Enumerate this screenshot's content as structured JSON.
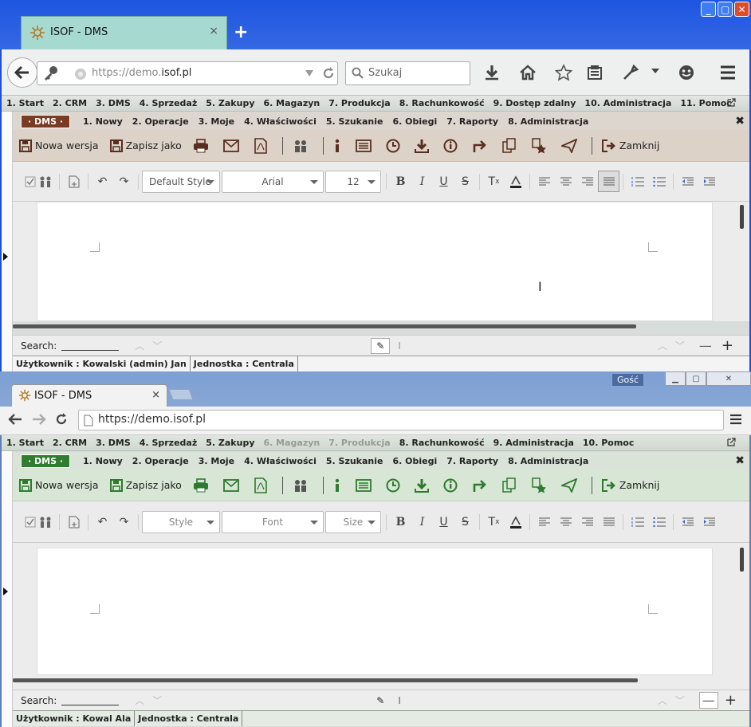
{
  "w1": {
    "tab_title": "ISOF - DMS",
    "tab_close": "×",
    "new_tab": "+",
    "url_prefix": "https://demo.",
    "url_host": "isof.pl",
    "search_placeholder": "Szukaj",
    "main_menu": [
      "1. Start",
      "2. CRM",
      "3. DMS",
      "4. Sprzedaż",
      "5. Zakupy",
      "6. Magazyn",
      "7. Produkcja",
      "8. Rachunkowość",
      "9. Dostęp zdalny",
      "10. Administracja",
      "11. Pomoc"
    ],
    "dms_badge": "· DMS ·",
    "sub_menu": [
      "1. Nowy",
      "2. Operacje",
      "3. Moje",
      "4. Właściwości",
      "5. Szukanie",
      "6. Obiegi",
      "7. Raporty",
      "8. Administracja"
    ],
    "new_version": "Nowa wersja",
    "save_as": "Zapisz jako",
    "close": "Zamknij",
    "style_select": "Default Style",
    "font_select": "Arial",
    "size_select": "12",
    "search_label": "Search:",
    "status_user": "Użytkownik : Kowalski (admin) Jan",
    "status_unit": "Jednostka : Centrala"
  },
  "w2": {
    "tab_title": "ISOF - DMS",
    "tab_close": "×",
    "guest": "Gość",
    "url": "https://demo.isof.pl",
    "main_menu": [
      "1. Start",
      "2. CRM",
      "3. DMS",
      "4. Sprzedaż",
      "5. Zakupy",
      "6. Magazyn",
      "7. Produkcja",
      "8. Rachunkowość",
      "9. Administracja",
      "10. Pomoc"
    ],
    "main_menu_disabled": [
      false,
      false,
      false,
      false,
      false,
      true,
      true,
      false,
      false,
      false
    ],
    "dms_badge": "· DMS ·",
    "sub_menu": [
      "1. Nowy",
      "2. Operacje",
      "3. Moje",
      "4. Właściwości",
      "5. Szukanie",
      "6. Obiegi",
      "7. Raporty",
      "8. Administracja"
    ],
    "new_version": "Nowa wersja",
    "save_as": "Zapisz jako",
    "close": "Zamknij",
    "style_select": "Style",
    "font_select": "Font",
    "size_select": "Size",
    "search_label": "Search:",
    "status_user": "Użytkownik : Kowal Ala",
    "status_unit": "Jednostka : Centrala"
  },
  "colors": {
    "w1_toolbar": "#dcd2c8",
    "w1_submenu": "#dcd6ce",
    "w1_badge": "#7a3b22",
    "w1_icon": "#5a2e1e",
    "w2_toolbar": "#d7e6d5",
    "w2_submenu": "#d9e3d8",
    "w2_badge": "#2f7d2f",
    "w2_icon": "#2e7a2e"
  }
}
